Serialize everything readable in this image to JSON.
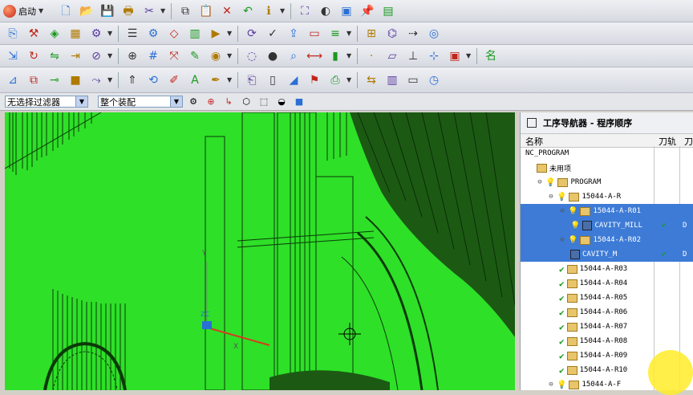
{
  "toolbar": {
    "start_label": "启动",
    "row1_icons": [
      "new-file-icon",
      "open-folder-icon",
      "save-icon",
      "print-icon",
      "cut-icon",
      "copy-icon",
      "paste-icon",
      "delete-icon",
      "undo-icon",
      "info-icon",
      "fit-view-icon",
      "shade-icon",
      "cube-view-icon",
      "pin-icon",
      "layer-icon"
    ],
    "row2_icons": [
      "create-program-icon",
      "create-tool-icon",
      "create-geometry-icon",
      "create-method-icon",
      "create-operation-icon",
      "program-view-icon",
      "machine-view-icon",
      "geometry-view-icon",
      "method-view-icon",
      "generate-path-icon",
      "replay-path-icon",
      "verify-path-icon",
      "postprocess-icon",
      "shop-doc-icon",
      "clsf-icon",
      "tool-list-icon",
      "machine-tool-icon",
      "feeds-icon",
      "sim-icon"
    ],
    "row3_icons": [
      "move-icon",
      "rotate-icon",
      "mirror-icon",
      "offset-icon",
      "split-icon",
      "merge-icon",
      "grid-icon",
      "transform-icon",
      "edit-icon",
      "display-icon",
      "hide-icon",
      "show-icon",
      "analyze-icon",
      "measure-icon",
      "thickness-icon",
      "point-icon",
      "plane-icon",
      "axis-icon",
      "csys-icon",
      "cam-icon",
      "name-icon"
    ],
    "row4_icons": [
      "wcs-icon",
      "copy-object-icon",
      "attach-icon",
      "block-icon",
      "sweep-icon",
      "extrude-icon",
      "revolve-icon",
      "sketch-icon",
      "text-icon",
      "pen-icon",
      "paste-object-icon",
      "sheet-icon",
      "measure-distance-icon",
      "flag-icon",
      "printer-icon",
      "swap-icon",
      "library-icon",
      "display-screen-icon",
      "clock-icon"
    ],
    "name_glyph": "名"
  },
  "filters": {
    "selection_filter": "无选择过滤器",
    "assembly_scope": "整个装配"
  },
  "navigator": {
    "title": "工序导航器 - 程序顺序",
    "col_name": "名称",
    "col_path": "刀轨",
    "col_tool": "刀",
    "rows": [
      {
        "label": "NC_PROGRAM",
        "indent": 0,
        "icons": []
      },
      {
        "label": "未用项",
        "indent": 1,
        "icons": [
          "folder"
        ]
      },
      {
        "label": "PROGRAM",
        "indent": 1,
        "icons": [
          "expander",
          "bulb",
          "folder"
        ]
      },
      {
        "label": "15044-A-R",
        "indent": 2,
        "icons": [
          "expander",
          "bulb",
          "folder"
        ]
      },
      {
        "label": "15044-A-R01",
        "indent": 3,
        "icons": [
          "expander",
          "bulb",
          "folder"
        ],
        "selected": true
      },
      {
        "label": "CAVITY_MILL",
        "indent": 4,
        "icons": [
          "bulb",
          "op"
        ],
        "selected": true,
        "path": "✔",
        "tool": "D"
      },
      {
        "label": "15044-A-R02",
        "indent": 3,
        "icons": [
          "expander",
          "bulb",
          "folder"
        ],
        "selected": true
      },
      {
        "label": "CAVITY_M",
        "indent": 4,
        "icons": [
          "op"
        ],
        "selected": true,
        "path": "✔",
        "tool": "D"
      },
      {
        "label": "15044-A-R03",
        "indent": 3,
        "icons": [
          "chk",
          "folder"
        ]
      },
      {
        "label": "15044-A-R04",
        "indent": 3,
        "icons": [
          "chk",
          "folder"
        ]
      },
      {
        "label": "15044-A-R05",
        "indent": 3,
        "icons": [
          "chk",
          "folder"
        ]
      },
      {
        "label": "15044-A-R06",
        "indent": 3,
        "icons": [
          "chk",
          "folder"
        ]
      },
      {
        "label": "15044-A-R07",
        "indent": 3,
        "icons": [
          "chk",
          "folder"
        ]
      },
      {
        "label": "15044-A-R08",
        "indent": 3,
        "icons": [
          "chk",
          "folder"
        ]
      },
      {
        "label": "15044-A-R09",
        "indent": 3,
        "icons": [
          "chk",
          "folder"
        ]
      },
      {
        "label": "15044-A-R10",
        "indent": 3,
        "icons": [
          "chk",
          "folder"
        ]
      },
      {
        "label": "15044-A-F",
        "indent": 2,
        "icons": [
          "expander",
          "bulb",
          "folder"
        ]
      }
    ]
  },
  "viewport": {
    "background": "#2ee028",
    "triad": {
      "x_label": "X",
      "y_label": "Y",
      "z_label": "ZC"
    }
  },
  "colors": {
    "accent_select": "#3d7bd6",
    "model_green": "#2ee028",
    "check_green": "#1a9a20",
    "cursor_highlight": "#ffec28"
  }
}
